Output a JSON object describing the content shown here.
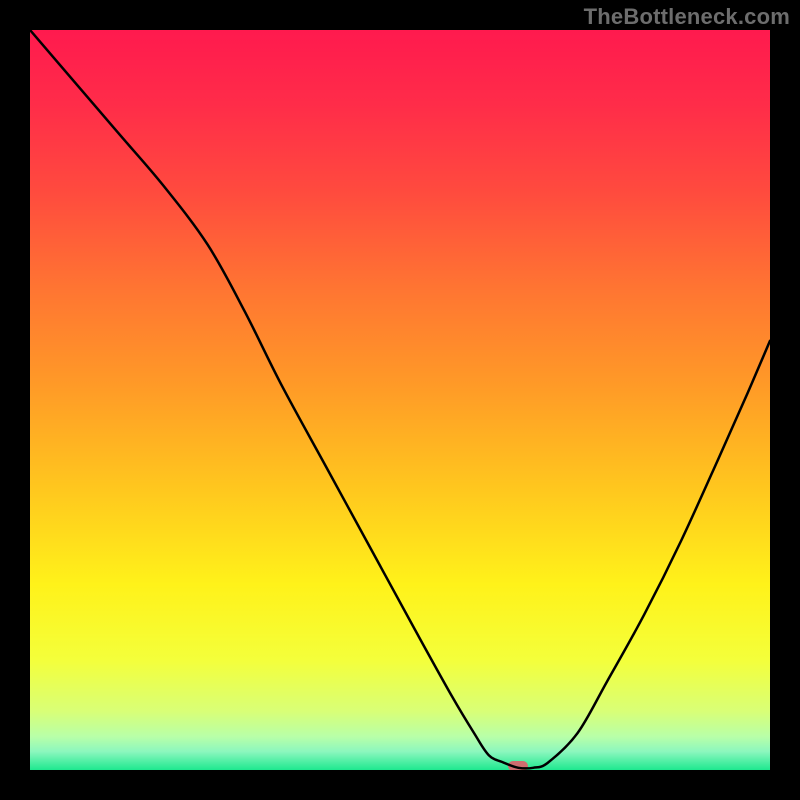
{
  "watermark": "TheBottleneck.com",
  "chart_data": {
    "type": "line",
    "title": "",
    "xlabel": "",
    "ylabel": "",
    "xlim": [
      0,
      100
    ],
    "ylim": [
      0,
      100
    ],
    "x": [
      0,
      6,
      12,
      18,
      24,
      29,
      34,
      40,
      46,
      52,
      57,
      60,
      62,
      64,
      66,
      68,
      70,
      74,
      78,
      83,
      88,
      93,
      97,
      100
    ],
    "values": [
      100,
      93,
      86,
      79,
      71,
      62,
      52,
      41,
      30,
      19,
      10,
      5,
      2,
      1,
      0.3,
      0.3,
      1,
      5,
      12,
      21,
      31,
      42,
      51,
      58
    ],
    "gradient_stops": [
      {
        "pos": 0.0,
        "color": "#ff1a4e"
      },
      {
        "pos": 0.1,
        "color": "#ff2c49"
      },
      {
        "pos": 0.22,
        "color": "#ff4b3e"
      },
      {
        "pos": 0.35,
        "color": "#ff7532"
      },
      {
        "pos": 0.48,
        "color": "#ff9a27"
      },
      {
        "pos": 0.62,
        "color": "#ffc71e"
      },
      {
        "pos": 0.75,
        "color": "#fff21a"
      },
      {
        "pos": 0.85,
        "color": "#f4ff3a"
      },
      {
        "pos": 0.92,
        "color": "#d9ff76"
      },
      {
        "pos": 0.955,
        "color": "#b8ffa8"
      },
      {
        "pos": 0.975,
        "color": "#8cf7be"
      },
      {
        "pos": 1.0,
        "color": "#1ee88f"
      }
    ],
    "marker": {
      "x": 66,
      "y": 0.5,
      "w_pct": 2.7,
      "h_pct": 1.3,
      "radius_pct": 0.7,
      "color": "#cf6d6f"
    }
  }
}
